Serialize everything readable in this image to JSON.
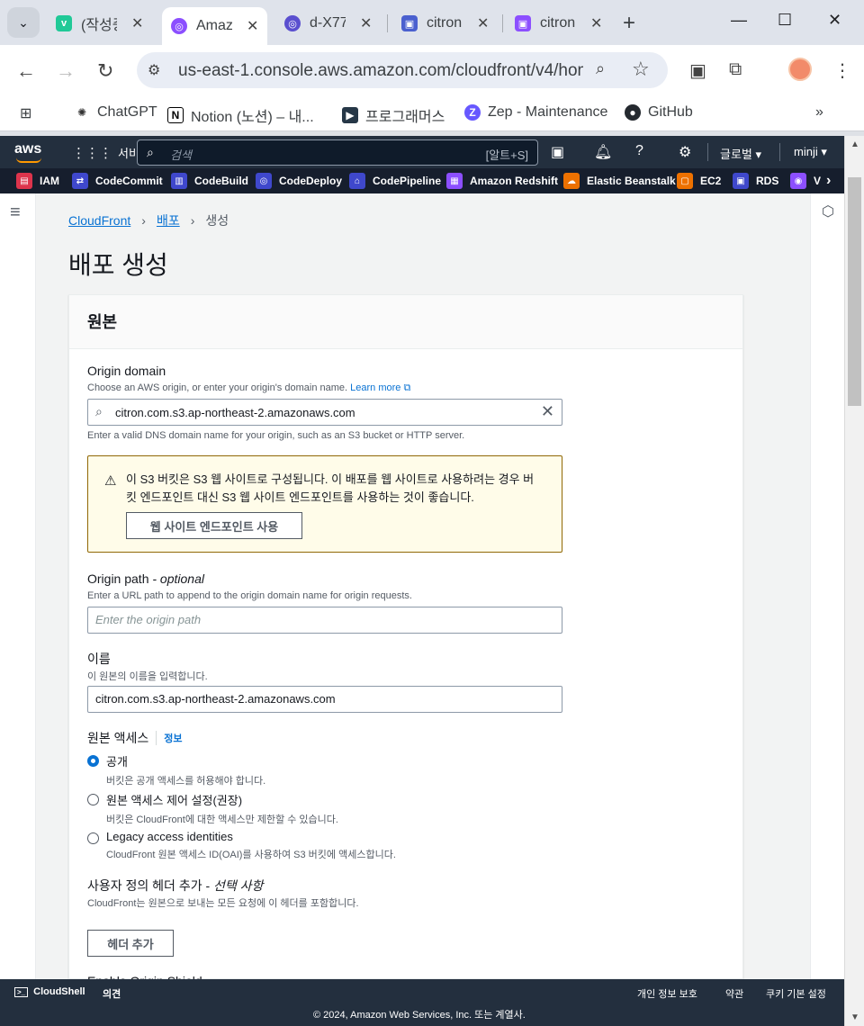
{
  "browser": {
    "tabs": [
      {
        "title": "(작성중",
        "favicon": "v",
        "color": "#20c997"
      },
      {
        "title": "Amaz",
        "favicon": "aws",
        "color": "#8c4fff",
        "active": true
      },
      {
        "title": "d-X77",
        "favicon": "aws",
        "color": "#5a4fcf"
      },
      {
        "title": "citron",
        "favicon": "aws",
        "color": "#4a60cf"
      },
      {
        "title": "citron",
        "favicon": "aws",
        "color": "#8c4fff"
      }
    ],
    "url": "us-east-1.console.aws.amazon.com/cloudfront/v4/hom...",
    "bookmarks": [
      "ChatGPT",
      "Notion (노션) – 내...",
      "프로그래머스",
      "Zep - Maintenance",
      "GitHub"
    ]
  },
  "aws": {
    "logo": "aws",
    "services_label": "서비스",
    "search_placeholder": "검색",
    "search_shortcut": "[알트+S]",
    "region": "글로벌 ▾",
    "user": "minji ▾",
    "favorites": [
      "IAM",
      "CodeCommit",
      "CodeBuild",
      "CodeDeploy",
      "CodePipeline",
      "Amazon Redshift",
      "Elastic Beanstalk",
      "EC2",
      "RDS",
      "V"
    ]
  },
  "breadcrumb": {
    "root": "CloudFront",
    "mid": "배포",
    "current": "생성"
  },
  "page_title": "배포 생성",
  "panel": {
    "heading": "원본",
    "origin_domain": {
      "label": "Origin domain",
      "desc": "Choose an AWS origin, or enter your origin's domain name.",
      "learn_more": "Learn more",
      "value": "citron.com.s3.ap-northeast-2.amazonaws.com",
      "hint": "Enter a valid DNS domain name for your origin, such as an S3 bucket or HTTP server."
    },
    "warning": {
      "text": "이 S3 버킷은 S3 웹 사이트로 구성됩니다. 이 배포를 웹 사이트로 사용하려는 경우 버킷 엔드포인트 대신 S3 웹 사이트 엔드포인트를 사용하는 것이 좋습니다.",
      "button": "웹 사이트 엔드포인트 사용"
    },
    "origin_path": {
      "label": "Origin path",
      "optional": "- optional",
      "desc": "Enter a URL path to append to the origin domain name for origin requests.",
      "placeholder": "Enter the origin path"
    },
    "name": {
      "label": "이름",
      "desc": "이 원본의 이름을 입력합니다.",
      "value": "citron.com.s3.ap-northeast-2.amazonaws.com"
    },
    "access": {
      "label": "원본 액세스",
      "info": "정보",
      "options": [
        {
          "label": "공개",
          "desc": "버킷은 공개 액세스를 허용해야 합니다.",
          "selected": true
        },
        {
          "label": "원본 액세스 제어 설정(권장)",
          "desc": "버킷은 CloudFront에 대한 액세스만 제한할 수 있습니다.",
          "selected": false
        },
        {
          "label": "Legacy access identities",
          "desc": "CloudFront 원본 액세스 ID(OAI)를 사용하여 S3 버킷에 액세스합니다.",
          "selected": false
        }
      ]
    },
    "headers": {
      "label": "사용자 정의 헤더 추가 -",
      "optional": "선택 사항",
      "desc": "CloudFront는 원본으로 보내는 모든 요청에 이 헤더를 포함합니다.",
      "button": "헤더 추가"
    },
    "cut_label": "Enable Origin Shield"
  },
  "footer": {
    "cloudshell": "CloudShell",
    "feedback": "의견",
    "privacy": "개인 정보 보호",
    "terms": "약관",
    "cookies": "쿠키 기본 설정",
    "copyright": "© 2024, Amazon Web Services, Inc. 또는 계열사."
  }
}
